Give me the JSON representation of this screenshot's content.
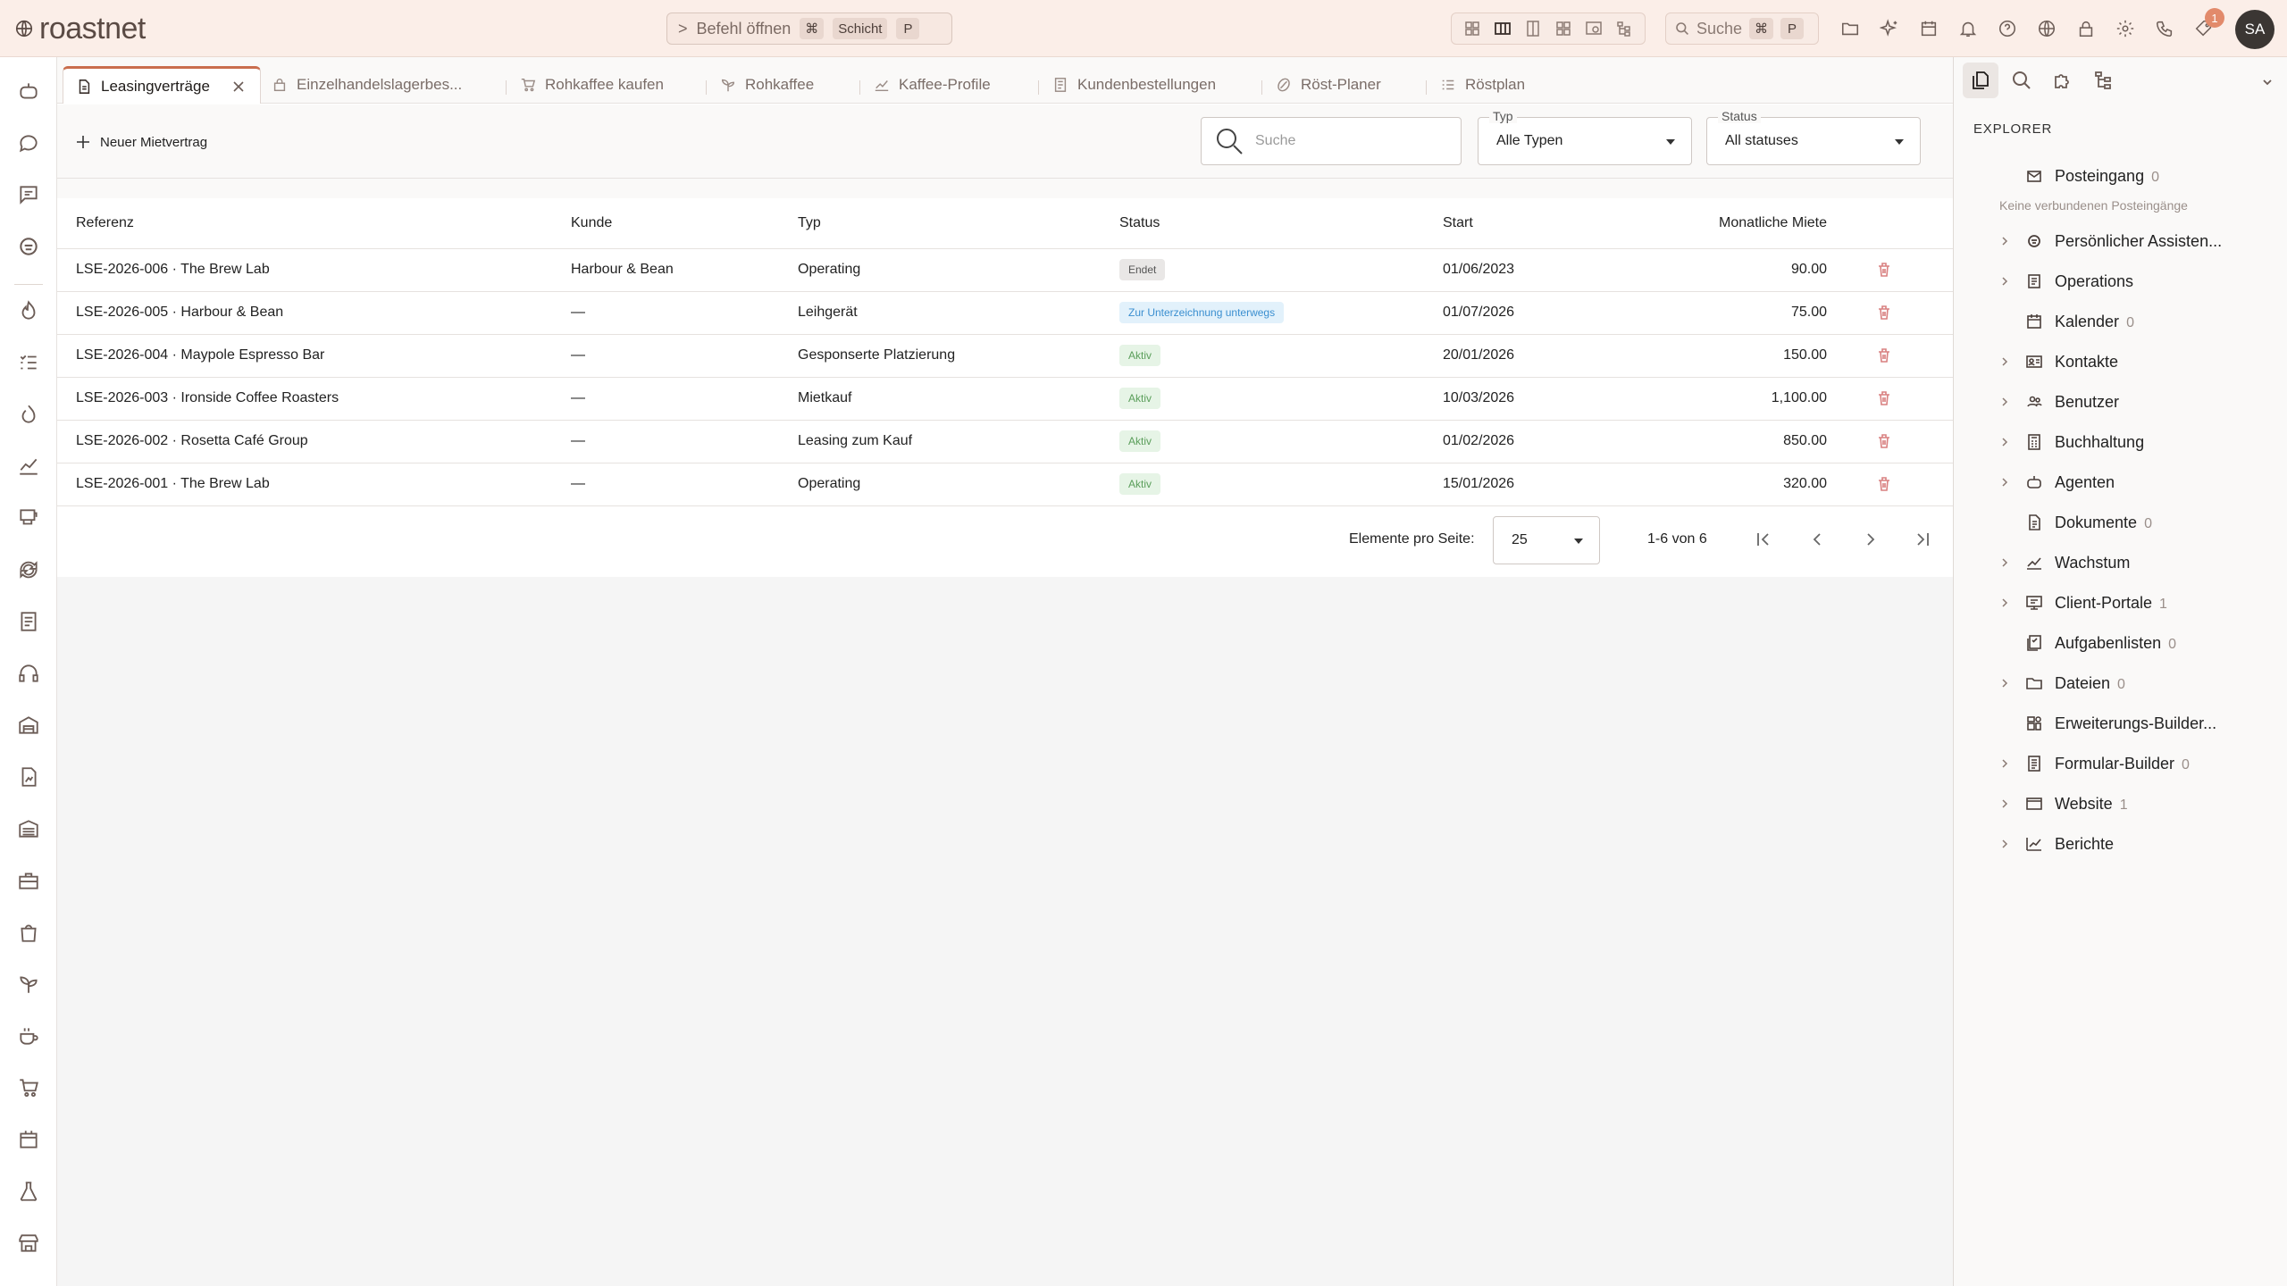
{
  "app": {
    "brand": "roastnet"
  },
  "topbar": {
    "command": {
      "chevron": ">",
      "label": "Befehl öffnen",
      "keys": [
        "⌘",
        "Schicht",
        "P"
      ]
    },
    "search": {
      "label": "Suche",
      "keys": [
        "⌘",
        "P"
      ]
    },
    "notifications_count": "1",
    "avatar_initials": "SA"
  },
  "tabs": [
    {
      "label": "Leasingverträge",
      "icon": "document-icon",
      "active": true
    },
    {
      "label": "Einzelhandelslagerbes...",
      "icon": "lock-icon"
    },
    {
      "label": "Rohkaffee kaufen",
      "icon": "cart-icon"
    },
    {
      "label": "Rohkaffee",
      "icon": "sprout-icon"
    },
    {
      "label": "Kaffee-Profile",
      "icon": "chart-icon"
    },
    {
      "label": "Kundenbestellungen",
      "icon": "list-icon"
    },
    {
      "label": "Röst-Planer",
      "icon": "bean-icon"
    },
    {
      "label": "Röstplan",
      "icon": "checklist-icon"
    }
  ],
  "toolbar": {
    "new_label": "Neuer Mietvertrag",
    "search_placeholder": "Suche",
    "type_filter": {
      "legend": "Typ",
      "value": "Alle Typen"
    },
    "status_filter": {
      "legend": "Status",
      "value": "All statuses"
    }
  },
  "table": {
    "columns": [
      "Referenz",
      "Kunde",
      "Typ",
      "Status",
      "Start",
      "Monatliche Miete"
    ],
    "rows": [
      {
        "ref": "LSE-2026-006 · The Brew Lab",
        "kunde": "Harbour & Bean",
        "typ": "Operating",
        "status": "Endet",
        "status_kind": "ended",
        "start": "01/06/2023",
        "rent": "90.00"
      },
      {
        "ref": "LSE-2026-005 · Harbour & Bean",
        "kunde": "—",
        "typ": "Leihgerät",
        "status": "Zur Unterzeichnung unterwegs",
        "status_kind": "pending",
        "start": "01/07/2026",
        "rent": "75.00"
      },
      {
        "ref": "LSE-2026-004 · Maypole Espresso Bar",
        "kunde": "—",
        "typ": "Gesponserte Platzierung",
        "status": "Aktiv",
        "status_kind": "active",
        "start": "20/01/2026",
        "rent": "150.00"
      },
      {
        "ref": "LSE-2026-003 · Ironside Coffee Roasters",
        "kunde": "—",
        "typ": "Mietkauf",
        "status": "Aktiv",
        "status_kind": "active",
        "start": "10/03/2026",
        "rent": "1,100.00"
      },
      {
        "ref": "LSE-2026-002 · Rosetta Café Group",
        "kunde": "—",
        "typ": "Leasing zum Kauf",
        "status": "Aktiv",
        "status_kind": "active",
        "start": "01/02/2026",
        "rent": "850.00"
      },
      {
        "ref": "LSE-2026-001 · The Brew Lab",
        "kunde": "—",
        "typ": "Operating",
        "status": "Aktiv",
        "status_kind": "active",
        "start": "15/01/2026",
        "rent": "320.00"
      }
    ]
  },
  "pagination": {
    "per_page_label": "Elemente pro Seite:",
    "per_page": "25",
    "range": "1-6 von 6"
  },
  "status_colors": {
    "ended": {
      "bg": "#e9e7e6",
      "fg": "#555555"
    },
    "pending": {
      "bg": "#e2f1fb",
      "fg": "#3b8fd0"
    },
    "active": {
      "bg": "#e6f4e6",
      "fg": "#5a9e5a"
    }
  },
  "explorer": {
    "title": "EXPLORER",
    "note": "Keine verbundenen Posteingänge",
    "items": [
      {
        "label": "Posteingang",
        "count": "0",
        "expandable": false,
        "icon": "mail-icon"
      },
      {
        "label": "Persönlicher Assisten...",
        "count": "",
        "expandable": true,
        "icon": "robot-icon"
      },
      {
        "label": "Operations",
        "count": "",
        "expandable": true,
        "icon": "book-icon"
      },
      {
        "label": "Kalender",
        "count": "0",
        "expandable": false,
        "icon": "calendar-icon"
      },
      {
        "label": "Kontakte",
        "count": "",
        "expandable": true,
        "icon": "contact-card-icon"
      },
      {
        "label": "Benutzer",
        "count": "",
        "expandable": true,
        "icon": "users-icon"
      },
      {
        "label": "Buchhaltung",
        "count": "",
        "expandable": true,
        "icon": "calculator-icon"
      },
      {
        "label": "Agenten",
        "count": "",
        "expandable": true,
        "icon": "agent-icon"
      },
      {
        "label": "Dokumente",
        "count": "0",
        "expandable": false,
        "icon": "documents-icon"
      },
      {
        "label": "Wachstum",
        "count": "",
        "expandable": true,
        "icon": "growth-chart-icon"
      },
      {
        "label": "Client-Portale",
        "count": "1",
        "expandable": true,
        "icon": "portal-icon"
      },
      {
        "label": "Aufgabenlisten",
        "count": "0",
        "expandable": false,
        "icon": "tasklist-icon"
      },
      {
        "label": "Dateien",
        "count": "0",
        "expandable": true,
        "icon": "folder-icon"
      },
      {
        "label": "Erweiterungs-Builder...",
        "count": "",
        "expandable": false,
        "icon": "extension-icon"
      },
      {
        "label": "Formular-Builder",
        "count": "0",
        "expandable": true,
        "icon": "form-icon"
      },
      {
        "label": "Website",
        "count": "1",
        "expandable": true,
        "icon": "browser-icon"
      },
      {
        "label": "Berichte",
        "count": "",
        "expandable": true,
        "icon": "report-chart-icon"
      }
    ]
  }
}
